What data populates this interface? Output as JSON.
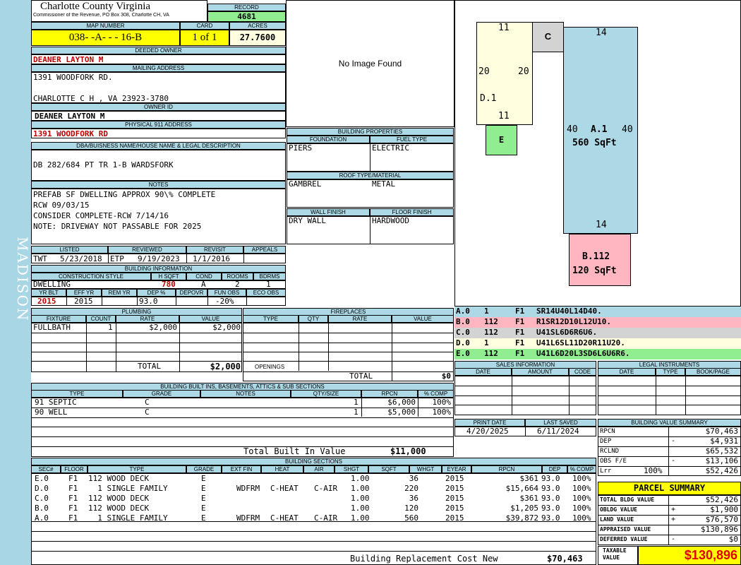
{
  "side_label": "MADISON",
  "header": {
    "county": "Charlotte County Virginia",
    "commissioner": "Commissioner of the Revenue, PO Box 308, Charlotte CH, VA",
    "record_label": "RECORD",
    "record": "4681",
    "map_label": "MAP NUMBER",
    "map": "038- -A- - - 16-B",
    "card_label": "CARD",
    "card": "1 of 1",
    "acres_label": "ACRES",
    "acres": "27.7600"
  },
  "owner": {
    "deeded_label": "DEEDED OWNER",
    "deeded": "DEANER LAYTON M",
    "mailing_label": "MAILING ADDRESS",
    "mail1": "1391 WOODFORK RD.",
    "mail2": "CHARLOTTE C H , VA 23923-3780",
    "ownerid_label": "OWNER ID",
    "ownerid": "DEANER LAYTON M",
    "phys_label": "PHYSICAL 911 ADDRESS",
    "phys": "1391 WOODFORK RD"
  },
  "desc": {
    "label": "DBA/BUISNESS NAME/HOUSE NAME & LEGAL DESCRIPTION",
    "text": "DB 282/684 PT TR 1-B WARDSFORK"
  },
  "notes": {
    "label": "NOTES",
    "lines": [
      "PREFAB SF DWELLING APPROX 90\\% COMPLETE",
      "RCW 09/03/15",
      "CONSIDER COMPLETE-RCW 7/14/16",
      "NOTE: DRIVEWAY NOT PASSABLE FOR 2025"
    ]
  },
  "dates": {
    "h": [
      "LISTED",
      "REVIEWED",
      "REVISIT",
      "APPEALS"
    ],
    "listed_by": "TWT",
    "listed": "5/23/2018",
    "reviewed_by": "ETP",
    "reviewed": "9/19/2023",
    "revisit": "1/1/2016",
    "appeals": ""
  },
  "bldg_info": {
    "label": "BUILDING INFORMATION",
    "h": [
      "CONSTRUCTION STYLE",
      "H SQFT",
      "COND",
      "ROOMS",
      "BDRMS"
    ],
    "style": "DWELLING",
    "hsqft": "780",
    "cond": "A",
    "rooms": "2",
    "bdrms": "1",
    "h2": [
      "YR BLT",
      "EFF YR",
      "REM YR",
      "DEP %",
      "DEPOVR",
      "FUN OBS",
      "ECO OBS"
    ],
    "yrblt": "2015",
    "effyr": "2015",
    "remyr": "",
    "dep": "93.0",
    "depovr": "",
    "funobs": "-20%",
    "ecoobs": ""
  },
  "image_msg": "No Image Found",
  "props": {
    "label": "BUILDING PROPERTIES",
    "foundation_label": "FOUNDATION",
    "foundation": "PIERS",
    "fuel_label": "FUEL TYPE",
    "fuel": "ELECTRIC",
    "roof_label": "ROOF TYPE/MATERIAL",
    "roof1": "GAMBREL",
    "roof2": "METAL",
    "wall_label": "WALL FINISH",
    "wall": "DRY WALL",
    "floor_label": "FLOOR FINISH",
    "floor": "HARDWOOD"
  },
  "sketch": {
    "d1_top": "11",
    "d1_left": "20",
    "d1_right": "20",
    "d1_bottom": "11",
    "d1": "D.1",
    "c": "C",
    "e": "E",
    "a_top": "14",
    "a_left": "40",
    "a_right": "40",
    "a_label": "A.1",
    "a_area": "560 SqFt",
    "a_bottom": "14",
    "b_label": "B.112",
    "b_area": "120 SqFt",
    "colors": {
      "a": "#add8e6",
      "b": "#ffb6c1",
      "c": "#d3d3d3",
      "d": "#ffffe0",
      "e": "#90ee90"
    }
  },
  "legend": [
    {
      "a": "A.0",
      "b": "1",
      "c": "F1",
      "d": "SR14U40L14D40."
    },
    {
      "a": "B.0",
      "b": "112",
      "c": "F1",
      "d": "R1SR12D10L12U10."
    },
    {
      "a": "C.0",
      "b": "112",
      "c": "F1",
      "d": "U41SL6D6R6U6."
    },
    {
      "a": "D.0",
      "b": "1",
      "c": "F1",
      "d": "U41L6SL11D20R11U20."
    },
    {
      "a": "E.0",
      "b": "112",
      "c": "F1",
      "d": "U41L6D20L3SD6L6U6R6."
    }
  ],
  "plumbing": {
    "label": "PLUMBING",
    "h": [
      "FIXTURE",
      "COUNT",
      "RATE",
      "VALUE"
    ],
    "fixture": "FULLBATH",
    "count": "1",
    "rate": "$2,000",
    "value": "$2,000",
    "total_label": "TOTAL",
    "total": "$2,000"
  },
  "fireplaces": {
    "label": "FIREPLACES",
    "h": [
      "TYPE",
      "QTY",
      "RATE",
      "VALUE"
    ],
    "openings": "OPENINGS",
    "total_label": "TOTAL",
    "total": "$0"
  },
  "sales": {
    "label": "SALES INFORMATION",
    "h": [
      "DATE",
      "AMOUNT",
      "CODE"
    ]
  },
  "legal": {
    "label": "LEGAL INSTRUMENTS",
    "h": [
      "DATE",
      "TYPE",
      "BOOK/PAGE"
    ]
  },
  "builtins": {
    "label": "BUILDING BUILT INS, BASEMENTS, ATTICS & SUB SECTIONS",
    "h": [
      "TYPE",
      "GRADE",
      "NOTES",
      "QTY/SIZE",
      "RPCN",
      "% COMP"
    ],
    "rows": [
      {
        "type": "91 SEPTIC",
        "grade": "C",
        "qty": "1",
        "rpcn": "$6,000",
        "comp": "100%"
      },
      {
        "type": "90 WELL",
        "grade": "C",
        "qty": "1",
        "rpcn": "$5,000",
        "comp": "100%"
      }
    ],
    "total_label": "Total Built In Value",
    "total": "$11,000"
  },
  "print": {
    "h": [
      "PRINT DATE",
      "LAST SAVED"
    ],
    "print": "4/20/2025",
    "saved": "6/11/2024"
  },
  "bvs": {
    "label": "BUILDING VALUE SUMMARY",
    "rows": [
      {
        "l": "RPCN",
        "s": "",
        "v": "$70,463"
      },
      {
        "l": "DEP",
        "s": "-",
        "v": "$4,931"
      },
      {
        "l": "RCLND",
        "s": "",
        "v": "$65,532"
      },
      {
        "l": "OBS F/E",
        "s": "-",
        "v": "$13,106"
      },
      {
        "l": "Lrr",
        "s": "100%",
        "v": "$52,426"
      }
    ]
  },
  "sections": {
    "label": "BUILDING SECTIONS",
    "h": [
      "SEC#",
      "FLOOR",
      "TYPE",
      "GRADE",
      "EXT FIN",
      "HEAT",
      "AIR",
      "SHGT",
      "SQFT",
      "WHGT",
      "EYEAR",
      "RPCN",
      "DEP",
      "% COMP"
    ],
    "rows": [
      {
        "sec": "E.0",
        "fl": "F1",
        "type": "112 WOOD DECK",
        "gr": "E",
        "ext": "",
        "heat": "",
        "air": "",
        "shgt": "1.00",
        "sqft": "36",
        "ey": "2015",
        "rpcn": "$361",
        "dep": "93.0",
        "comp": "100%"
      },
      {
        "sec": "D.0",
        "fl": "F1",
        "type": "  1 SINGLE FAMILY",
        "gr": "E",
        "ext": "WDFRM",
        "heat": "C-HEAT",
        "air": "C-AIR",
        "shgt": "1.00",
        "sqft": "220",
        "ey": "2015",
        "rpcn": "$15,664",
        "dep": "93.0",
        "comp": "100%"
      },
      {
        "sec": "C.0",
        "fl": "F1",
        "type": "112 WOOD DECK",
        "gr": "E",
        "ext": "",
        "heat": "",
        "air": "",
        "shgt": "1.00",
        "sqft": "36",
        "ey": "2015",
        "rpcn": "$361",
        "dep": "93.0",
        "comp": "100%"
      },
      {
        "sec": "B.0",
        "fl": "F1",
        "type": "112 WOOD DECK",
        "gr": "E",
        "ext": "",
        "heat": "",
        "air": "",
        "shgt": "1.00",
        "sqft": "120",
        "ey": "2015",
        "rpcn": "$1,205",
        "dep": "93.0",
        "comp": "100%"
      },
      {
        "sec": "A.0",
        "fl": "F1",
        "type": "  1 SINGLE FAMILY",
        "gr": "E",
        "ext": "WDFRM",
        "heat": "C-HEAT",
        "air": "C-AIR",
        "shgt": "1.00",
        "sqft": "560",
        "ey": "2015",
        "rpcn": "$39,872",
        "dep": "93.0",
        "comp": "100%"
      }
    ],
    "brcn_label": "Building Replacement Cost New",
    "brcn": "$70,463"
  },
  "parcel": {
    "label": "PARCEL SUMMARY",
    "rows": [
      {
        "l": "TOTAL BLDG VALUE",
        "s": "",
        "v": "$52,426"
      },
      {
        "l": "OBLDG VALUE",
        "s": "+",
        "v": "$1,900"
      },
      {
        "l": "LAND VALUE",
        "s": "+",
        "v": "$76,570"
      },
      {
        "l": "APPRAISED VALUE",
        "s": "",
        "v": "$130,896"
      },
      {
        "l": "DEFERRED VALUE",
        "s": "-",
        "v": "$0"
      }
    ],
    "taxable_label": "TAXABLE VALUE",
    "taxable": "$130,896"
  }
}
